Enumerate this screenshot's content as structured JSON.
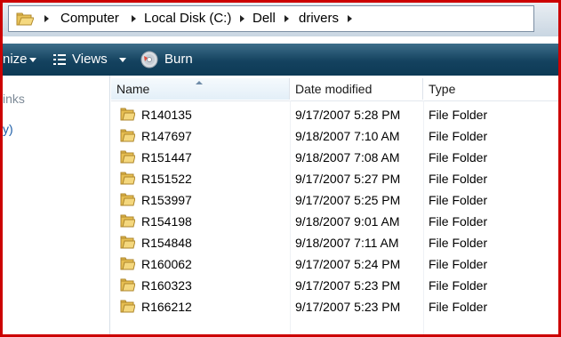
{
  "address": {
    "crumbs": [
      "Computer",
      "Local Disk (C:)",
      "Dell",
      "drivers"
    ]
  },
  "toolbar": {
    "organize_label": "nize",
    "views_label": "Views",
    "burn_label": "Burn"
  },
  "nav": {
    "links_label": "inks",
    "fragment_label": "y)"
  },
  "columns": {
    "name": "Name",
    "date": "Date modified",
    "type": "Type"
  },
  "files": [
    {
      "name": "R140135",
      "date": "9/17/2007 5:28 PM",
      "type": "File Folder"
    },
    {
      "name": "R147697",
      "date": "9/18/2007 7:10 AM",
      "type": "File Folder"
    },
    {
      "name": "R151447",
      "date": "9/18/2007 7:08 AM",
      "type": "File Folder"
    },
    {
      "name": "R151522",
      "date": "9/17/2007 5:27 PM",
      "type": "File Folder"
    },
    {
      "name": "R153997",
      "date": "9/17/2007 5:25 PM",
      "type": "File Folder"
    },
    {
      "name": "R154198",
      "date": "9/18/2007 9:01 AM",
      "type": "File Folder"
    },
    {
      "name": "R154848",
      "date": "9/18/2007 7:11 AM",
      "type": "File Folder"
    },
    {
      "name": "R160062",
      "date": "9/17/2007 5:24 PM",
      "type": "File Folder"
    },
    {
      "name": "R160323",
      "date": "9/17/2007 5:23 PM",
      "type": "File Folder"
    },
    {
      "name": "R166212",
      "date": "9/17/2007 5:23 PM",
      "type": "File Folder"
    }
  ],
  "colors": {
    "frame": "#cc0000",
    "toolbar": "#14425f",
    "link": "#1f5fa8"
  },
  "icons": {
    "folder": "folder-icon",
    "views": "views-icon",
    "burn": "disc-icon"
  }
}
